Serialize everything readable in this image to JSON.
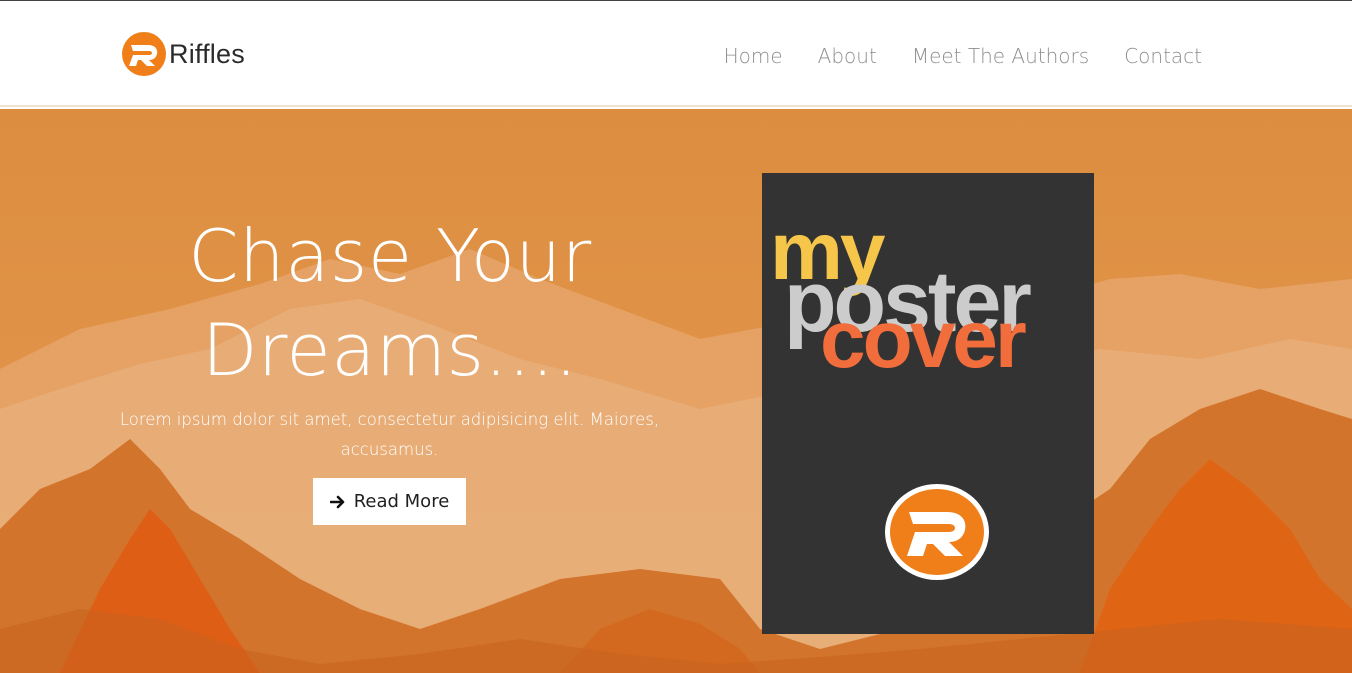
{
  "brand": {
    "name": "Riffles",
    "logo_icon": "riffles-r-logo-icon",
    "accent": "#f07f1a"
  },
  "nav": {
    "items": [
      {
        "label": "Home"
      },
      {
        "label": "About"
      },
      {
        "label": "Meet The Authors"
      },
      {
        "label": "Contact"
      }
    ]
  },
  "hero": {
    "title_line1": "Chase Your",
    "title_line2": "Dreams....",
    "subtitle": "Lorem ipsum dolor sit amet, consectetur adipisicing elit. Maiores, accusamus.",
    "button_label": "Read More",
    "button_icon": "arrow-right-icon",
    "overlay_color": "#e08a37"
  },
  "poster": {
    "word1": "my",
    "word2": "poster",
    "word3": "cover",
    "background": "#333333",
    "colors": {
      "word1": "#f6c64a",
      "word2": "#cccccc",
      "word3": "#f16d3b"
    },
    "logo_icon": "riffles-r-logo-icon"
  }
}
